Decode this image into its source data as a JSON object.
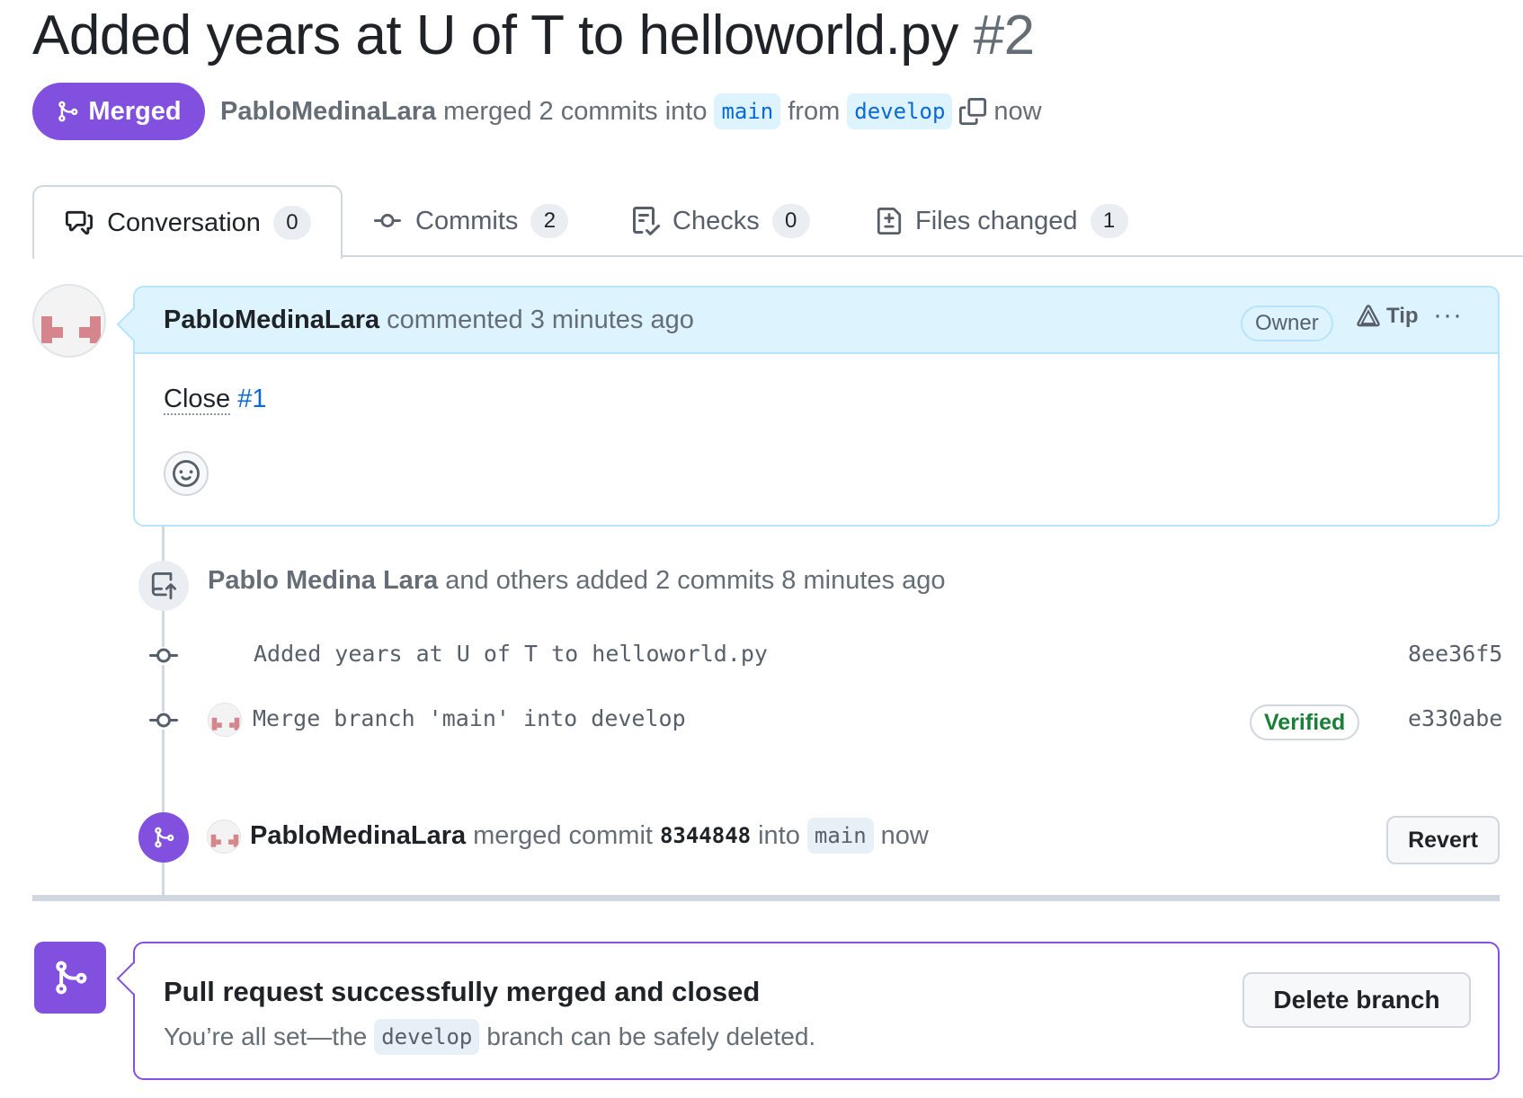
{
  "pr": {
    "title": "Added years at U of T to helloworld.py",
    "number": "#2",
    "state_label": "Merged",
    "author": "PabloMedinaLara",
    "merge_phrase": "merged 2 commits into",
    "base_branch": "main",
    "from_word": "from",
    "head_branch": "develop",
    "time": "now"
  },
  "tabs": [
    {
      "label": "Conversation",
      "count": "0",
      "icon": "comment-discussion-icon"
    },
    {
      "label": "Commits",
      "count": "2",
      "icon": "git-commit-icon"
    },
    {
      "label": "Checks",
      "count": "0",
      "icon": "checklist-icon"
    },
    {
      "label": "Files changed",
      "count": "1",
      "icon": "file-diff-icon"
    }
  ],
  "comment": {
    "author": "PabloMedinaLara",
    "meta": "commented 3 minutes ago",
    "badge": "Owner",
    "tip": "Tip",
    "more": "···",
    "body_text": "Close",
    "body_link": "#1"
  },
  "push_event": {
    "author": "Pablo Medina Lara",
    "text": "and others added 2 commits 8 minutes ago"
  },
  "commits": [
    {
      "message": "Added years at U of T to helloworld.py",
      "sha": "8ee36f5",
      "verified": ""
    },
    {
      "message": "Merge branch 'main' into develop",
      "sha": "e330abe",
      "verified": "Verified"
    }
  ],
  "merge_event": {
    "author": "PabloMedinaLara",
    "text": "merged commit",
    "sha": "8344848",
    "into_word": "into",
    "branch": "main",
    "time": "now",
    "revert_label": "Revert"
  },
  "merged_box": {
    "title": "Pull request successfully merged and closed",
    "sub_before": "You’re all set—the",
    "branch": "develop",
    "sub_after": "branch can be safely deleted.",
    "delete_label": "Delete branch"
  },
  "colors": {
    "merged_purple": "#8250df",
    "link_blue": "#0969da",
    "verified_green": "#1a7f37"
  }
}
